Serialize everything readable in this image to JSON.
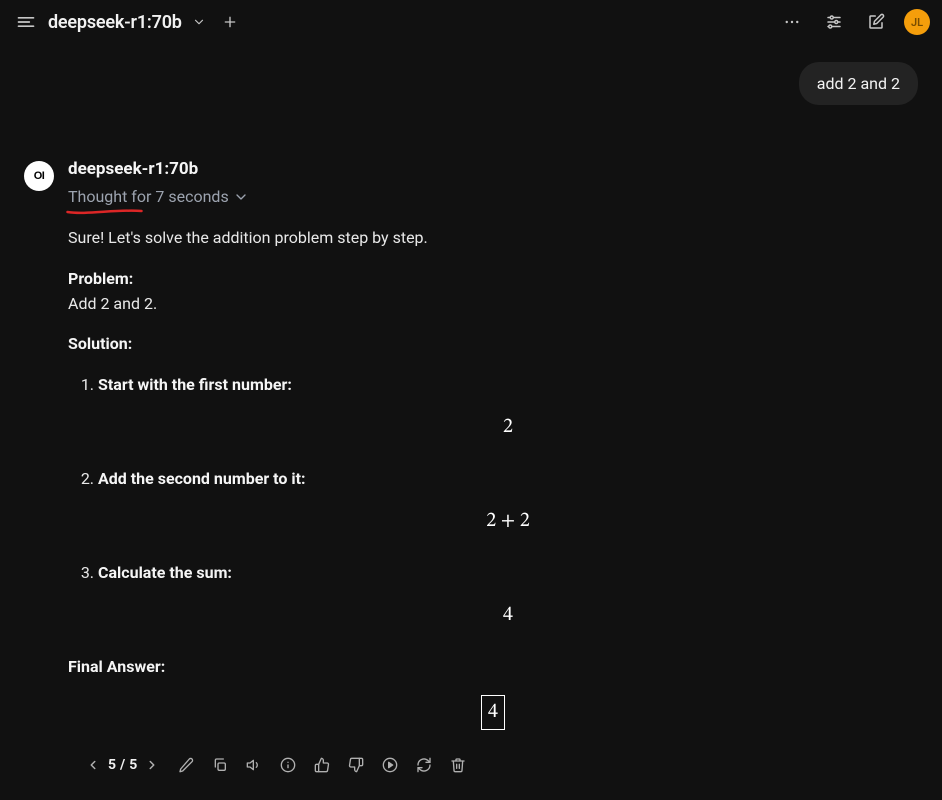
{
  "topbar": {
    "model": "deepseek-r1:70b",
    "avatar_initials": "JL"
  },
  "user_message": "add 2 and 2",
  "assistant": {
    "avatar_label": "OI",
    "model": "deepseek-r1:70b",
    "thought_label": "Thought for 7 seconds",
    "intro": "Sure! Let's solve the addition problem step by step.",
    "problem_heading": "Problem:",
    "problem_text": "Add 2 and 2.",
    "solution_heading": "Solution:",
    "steps": [
      {
        "text": "Start with the first number:",
        "math": "2"
      },
      {
        "text": "Add the second number to it:",
        "math": "2 + 2"
      },
      {
        "text": "Calculate the sum:",
        "math": "4"
      }
    ],
    "final_heading": "Final Answer:",
    "final_value": "4"
  },
  "actions": {
    "page_current": "5",
    "page_total": "5"
  }
}
